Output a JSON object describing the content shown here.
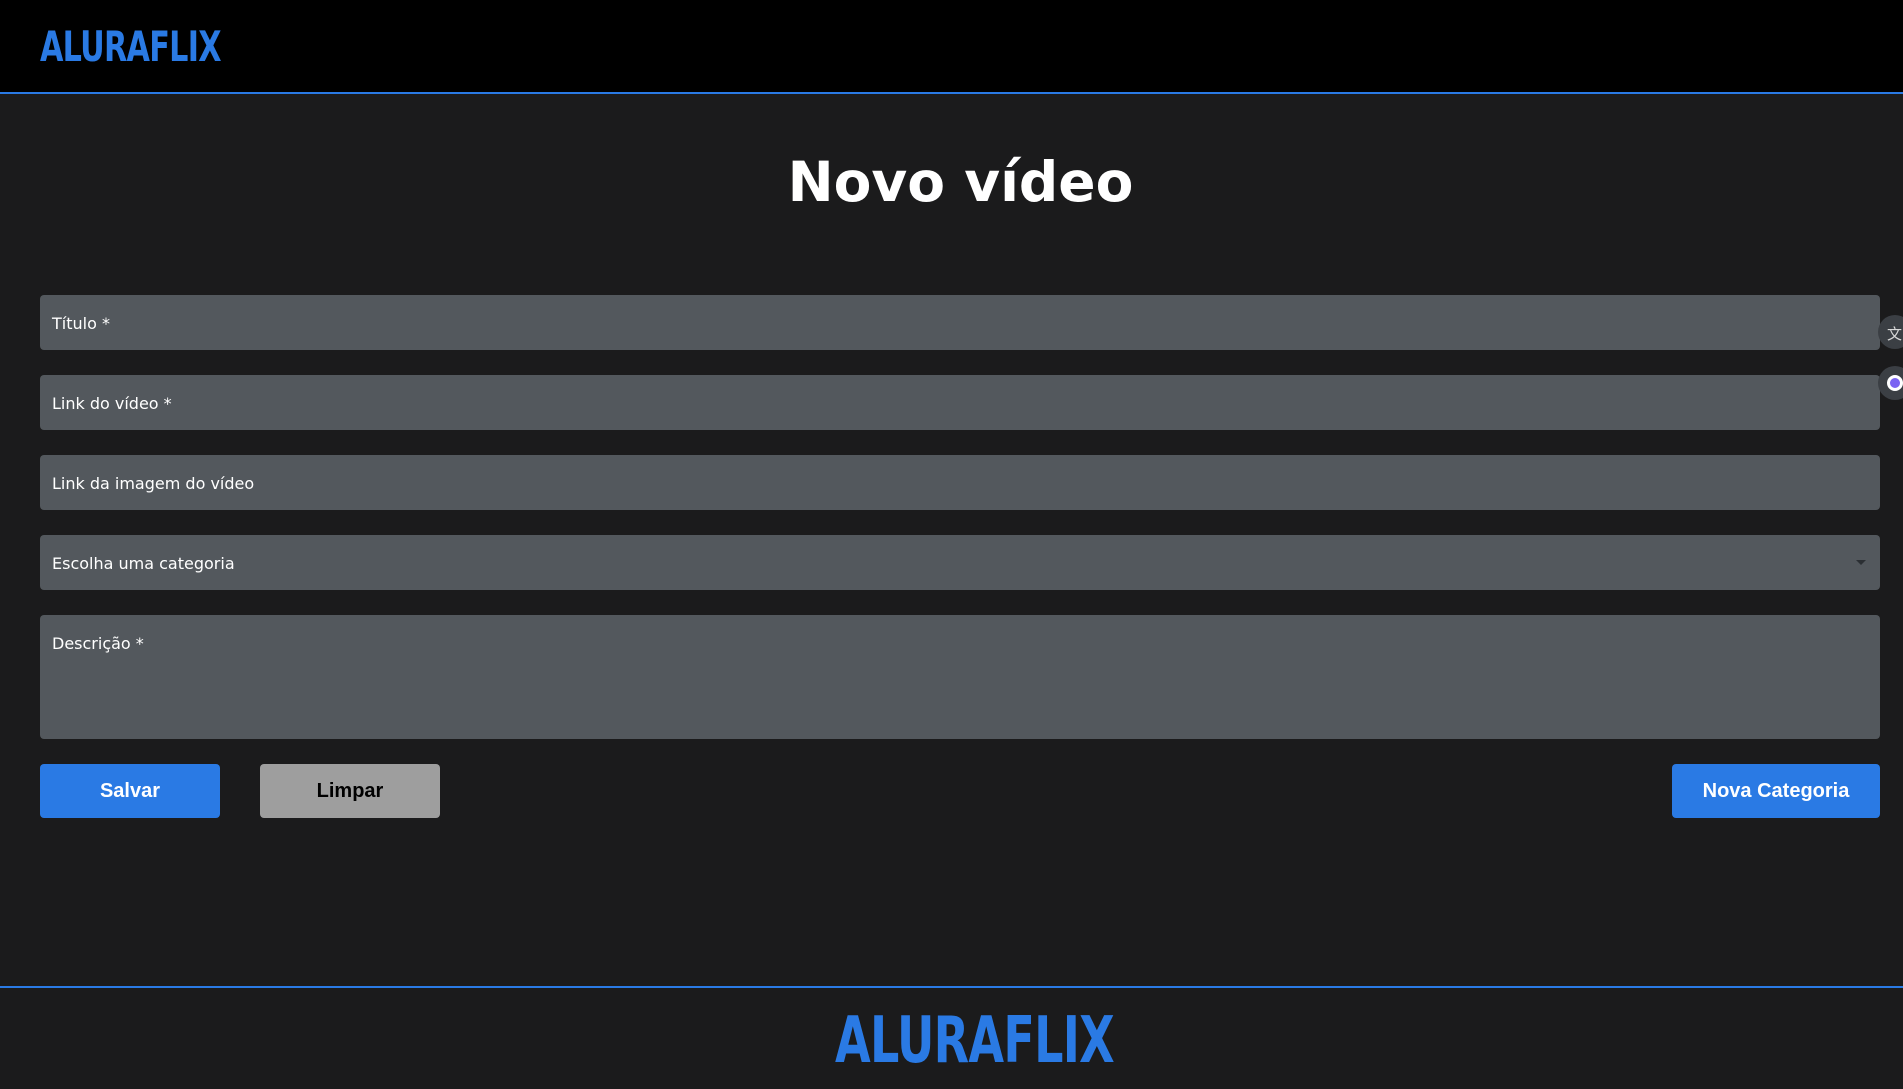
{
  "app": {
    "logo_text": "ALURAFLIX",
    "brand_color": "#2a7ae4",
    "background_color": "#1b1b1c"
  },
  "main": {
    "title": "Novo vídeo"
  },
  "form": {
    "fields": {
      "titulo": {
        "label": "Título *",
        "value": ""
      },
      "link_video": {
        "label": "Link do vídeo *",
        "value": ""
      },
      "link_imagem": {
        "label": "Link da imagem do vídeo",
        "value": ""
      },
      "categoria": {
        "label": "Escolha uma categoria",
        "selected": ""
      },
      "descricao": {
        "label": "Descrição *",
        "value": ""
      }
    },
    "buttons": {
      "salvar": "Salvar",
      "limpar": "Limpar",
      "nova_categoria": "Nova Categoria"
    }
  },
  "side_widgets": {
    "translate_icon": "translate-icon",
    "assistant_icon": "assistant-icon"
  },
  "footer": {
    "logo_text": "ALURAFLIX"
  }
}
